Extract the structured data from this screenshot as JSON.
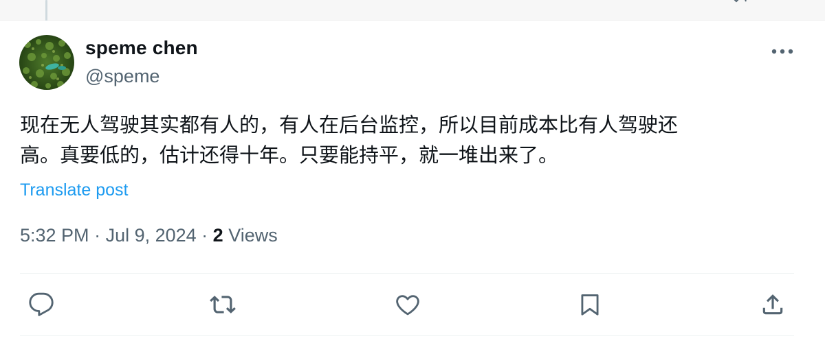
{
  "author": {
    "name": "speme chen",
    "handle": "@speme"
  },
  "post": {
    "text_line1": "现在无人驾驶其实都有人的，有人在后台监控，所以目前成本比有人驾驶还",
    "text_line2": "高。真要低的，估计还得十年。只要能持平，就一堆出来了。",
    "translate_label": "Translate post"
  },
  "meta": {
    "time": "5:32 PM",
    "separator": " · ",
    "date": "Jul 9, 2024",
    "views_count": "2",
    "views_label": " Views"
  },
  "icons": {
    "more": "more-horizontal-icon",
    "reply": "reply-icon",
    "repost": "repost-icon",
    "like": "heart-icon",
    "bookmark": "bookmark-icon",
    "share": "share-icon"
  },
  "colors": {
    "text": "#0f1419",
    "secondary": "#536471",
    "link": "#1d9bf0",
    "divider": "#eff3f4"
  }
}
